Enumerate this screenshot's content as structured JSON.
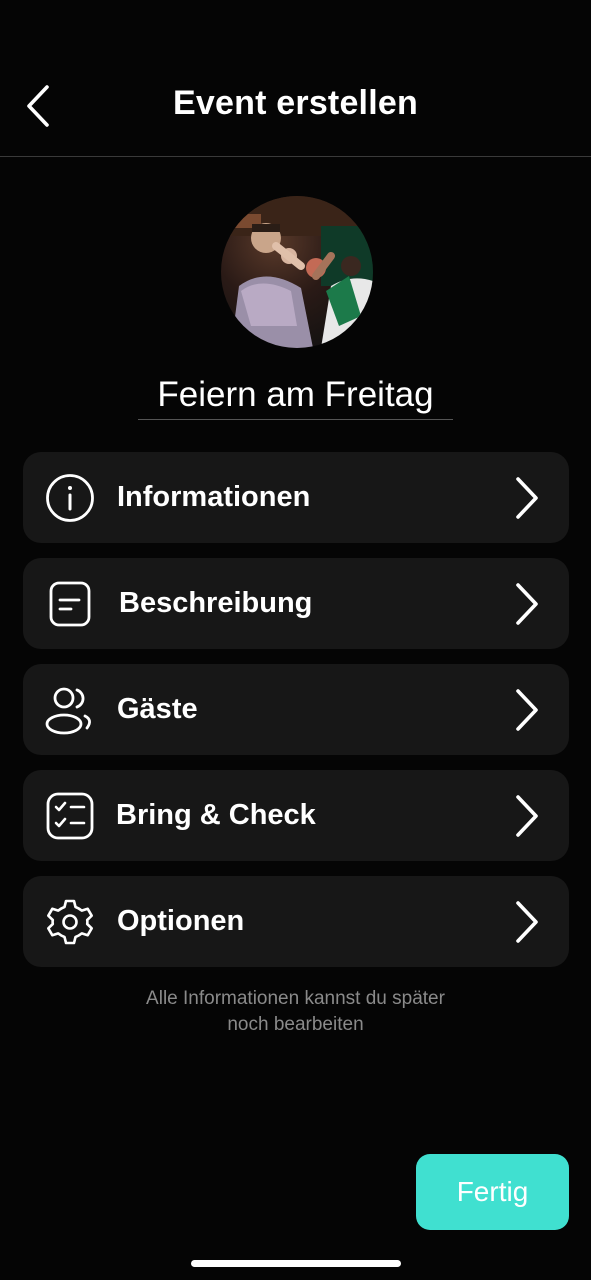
{
  "header": {
    "title": "Event erstellen",
    "back_icon": "chevron-left-icon"
  },
  "event": {
    "name": "Feiern am Freitag",
    "avatar": "event-photo"
  },
  "menu": [
    {
      "label": "Informationen",
      "icon": "info-icon"
    },
    {
      "label": "Beschreibung",
      "icon": "description-icon"
    },
    {
      "label": "Gäste",
      "icon": "guests-icon"
    },
    {
      "label": "Bring & Check",
      "icon": "checklist-icon"
    },
    {
      "label": "Optionen",
      "icon": "gear-icon"
    }
  ],
  "hint": {
    "line1": "Alle Informationen kannst du später",
    "line2": "noch bearbeiten"
  },
  "footer": {
    "done_label": "Fertig"
  },
  "colors": {
    "background": "#050505",
    "card": "#171717",
    "accent": "#40e0d0",
    "hint_text": "#8a8a8a"
  }
}
